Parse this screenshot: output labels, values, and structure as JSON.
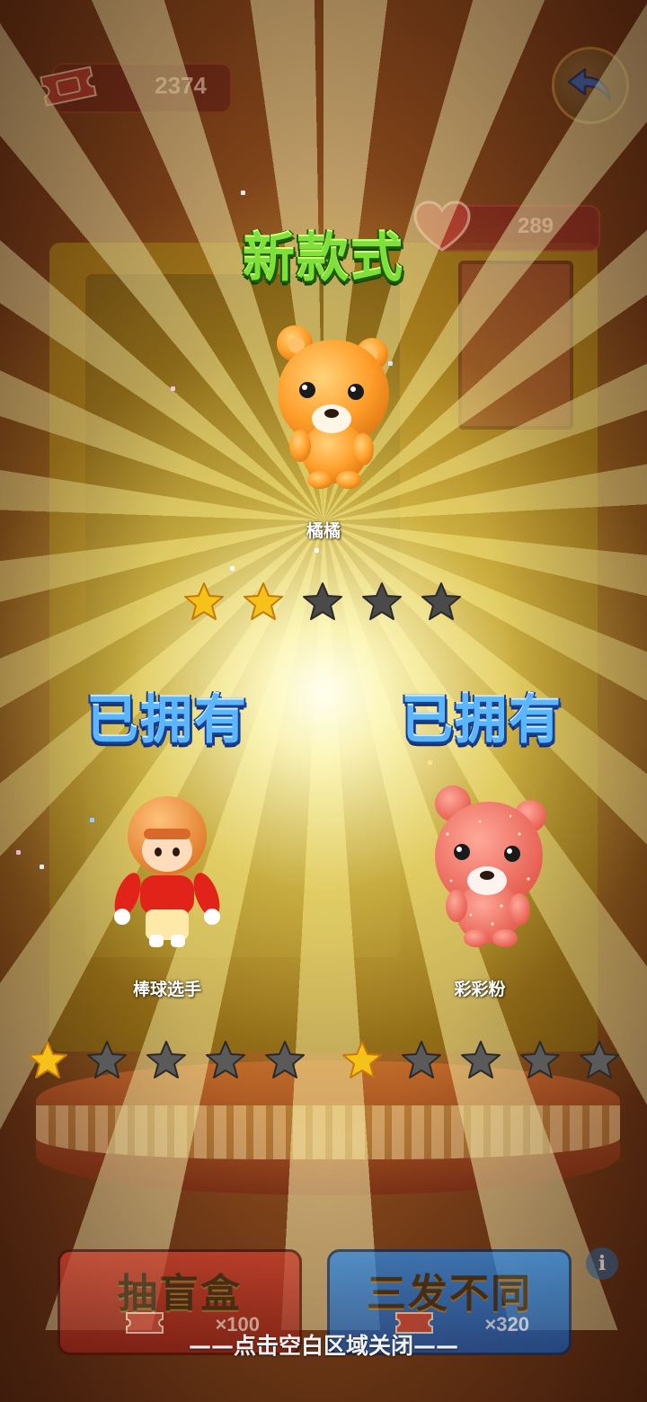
{
  "header": {
    "ticket_count": "2374",
    "heart_count": "289",
    "back_icon": "back-arrow-icon"
  },
  "reveal": {
    "new_title": "新款式",
    "new_item": {
      "name": "橘橘",
      "stars_filled": 2,
      "stars_total": 5
    },
    "owned_label": "已拥有",
    "owned_items": [
      {
        "name": "棒球选手",
        "stars_filled": 1,
        "stars_total": 5
      },
      {
        "name": "彩彩粉",
        "stars_filled": 1,
        "stars_total": 5
      }
    ]
  },
  "actions": {
    "draw_label": "抽盲盒",
    "draw_price": "×100",
    "triple_label": "三发不同",
    "triple_price": "×320",
    "info_icon": "i"
  },
  "close_hint": "——点击空白区域关闭——",
  "colors": {
    "star_gold": "#f6c21a",
    "star_empty": "#4a4a4a",
    "new_title_green": "#7ee03a",
    "owned_blue": "#5ab6ff"
  }
}
